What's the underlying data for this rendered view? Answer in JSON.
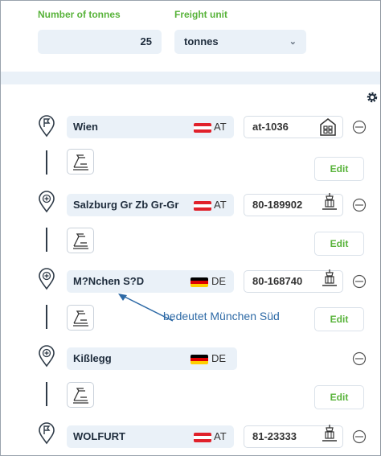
{
  "header": {
    "tonnes_label": "Number of tonnes",
    "tonnes_value": "25",
    "unit_label": "Freight unit",
    "unit_value": "tonnes"
  },
  "stops": [
    {
      "name": "Wien",
      "country": "AT",
      "code": "at-1036",
      "type": "flag",
      "side_icon": "building-icon"
    },
    {
      "name": "Salzburg Gr Zb Gr-Gr",
      "country": "AT",
      "code": "80-189902",
      "type": "plus",
      "side_icon": "crane-icon"
    },
    {
      "name": "M?Nchen S?D",
      "country": "DE",
      "code": "80-168740",
      "type": "plus",
      "side_icon": "crane-icon"
    },
    {
      "name": "Kißlegg",
      "country": "DE",
      "code": "",
      "type": "plus",
      "side_icon": ""
    },
    {
      "name": "WOLFURT",
      "country": "AT",
      "code": "81-23333",
      "type": "flag",
      "side_icon": "crane-icon"
    }
  ],
  "legs": [
    {
      "edit_label": "Edit"
    },
    {
      "edit_label": "Edit"
    },
    {
      "edit_label": "Edit"
    },
    {
      "edit_label": "Edit"
    }
  ],
  "annotation": "bedeutet München Süd",
  "colors": {
    "accent": "#58b33a",
    "field_bg": "#eaf1f8",
    "annotation": "#2e6aa6"
  }
}
